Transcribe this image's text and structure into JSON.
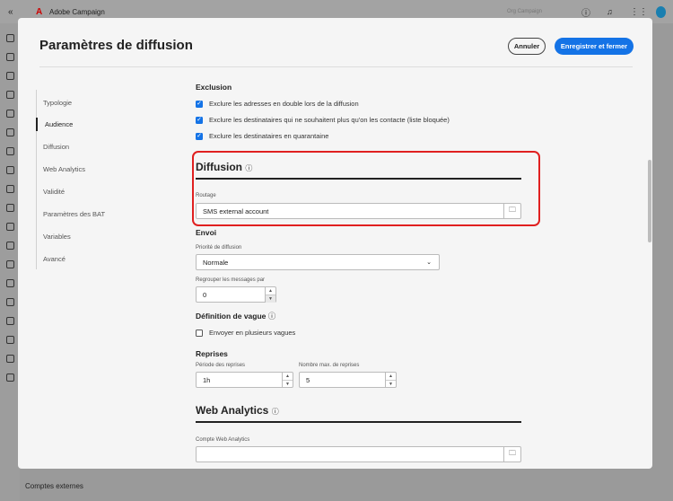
{
  "app": {
    "name": "Adobe Campaign",
    "org": "Org Campaign",
    "bottom_label": "Comptes externes"
  },
  "modal": {
    "title": "Paramètres de diffusion",
    "cancel": "Annuler",
    "save": "Enregistrer et fermer"
  },
  "nav": [
    {
      "label": "Typologie"
    },
    {
      "label": "Audience"
    },
    {
      "label": "Diffusion"
    },
    {
      "label": "Web Analytics"
    },
    {
      "label": "Validité"
    },
    {
      "label": "Paramètres des BAT"
    },
    {
      "label": "Variables"
    },
    {
      "label": "Avancé"
    }
  ],
  "exclusion": {
    "title": "Exclusion",
    "options": [
      {
        "label": "Exclure les adresses en double lors de la diffusion",
        "checked": true
      },
      {
        "label": "Exclure les destinataires qui ne souhaitent plus qu'on les contacte (liste bloquée)",
        "checked": true
      },
      {
        "label": "Exclure les destinataires en quarantaine",
        "checked": true
      }
    ]
  },
  "diffusion": {
    "title": "Diffusion",
    "routing_label": "Routage",
    "routing_value": "SMS external account"
  },
  "envoi": {
    "title": "Envoi",
    "priority_label": "Priorité de diffusion",
    "priority_value": "Normale",
    "group_label": "Regrouper les messages par",
    "group_value": "0"
  },
  "wave": {
    "title": "Définition de vague",
    "option": "Envoyer en plusieurs vagues",
    "checked": false
  },
  "retries": {
    "title": "Reprises",
    "period_label": "Période des reprises",
    "period_value": "1h",
    "max_label": "Nombre max. de reprises",
    "max_value": "5"
  },
  "web_analytics": {
    "title": "Web Analytics",
    "account_label": "Compte Web Analytics",
    "account_value": ""
  }
}
